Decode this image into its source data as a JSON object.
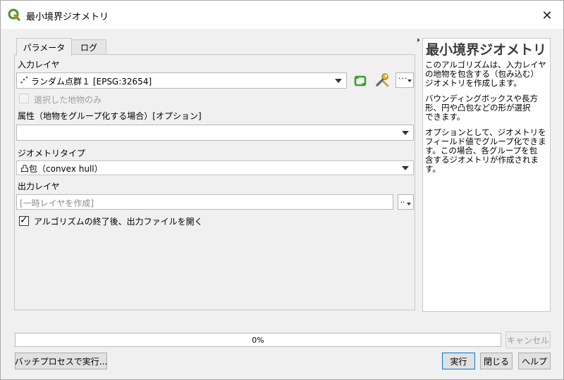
{
  "window": {
    "title": "最小境界ジオメトリ"
  },
  "tabs": [
    {
      "label": "パラメータ"
    },
    {
      "label": "ログ"
    }
  ],
  "params": {
    "input_layer_label": "入力レイヤ",
    "input_layer_value": "ランダム点群１ [EPSG:32654]",
    "selected_only_label": "選択した地物のみ",
    "attribute_label": "属性（地物をグループ化する場合）[オプション]",
    "attribute_value": "",
    "geometry_type_label": "ジオメトリタイプ",
    "geometry_type_value": "凸包（convex hull）",
    "output_layer_label": "出力レイヤ",
    "output_layer_placeholder": "[一時レイヤを作成]",
    "open_output_label": "アルゴリズムの終了後、出力ファイルを開く",
    "open_output_checked": true
  },
  "help": {
    "title": "最小境界ジオメトリ",
    "lines_p1": [
      "このアルゴリズムは、入力レイヤ",
      "の地物を包含する（包み込む）",
      "ジオメトリを作成します。"
    ],
    "lines_p2": [
      "バウンディングボックスや長方",
      "形、円や凸包などの形が選択",
      "できます。"
    ],
    "lines_p3": [
      "オプションとして、ジオメトリを",
      "フィールド値でグループ化できま",
      "す。この場合、各グループを包",
      "含するジオメトリが作成されま",
      "す。"
    ]
  },
  "progress": {
    "value": 0,
    "label": "0%"
  },
  "buttons": {
    "cancel": "キャンセル",
    "batch": "バッチプロセスで実行...",
    "run": "実行",
    "close": "閉じる",
    "help": "ヘルプ"
  },
  "colors": {
    "qgis_green": "#589632",
    "qgis_yellow": "#ee7913",
    "progress_green": "#06b025"
  }
}
